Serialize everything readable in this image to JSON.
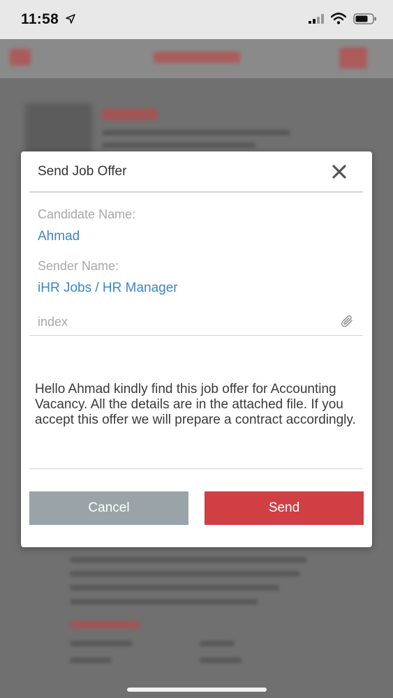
{
  "status_bar": {
    "time": "11:58"
  },
  "modal": {
    "title": "Send Job Offer",
    "candidate_label": "Candidate Name:",
    "candidate_value": "Ahmad",
    "sender_label": "Sender Name:",
    "sender_value": "iHR Jobs / HR Manager",
    "attachment_placeholder": "index",
    "message": "Hello Ahmad kindly find this job offer for Accounting Vacancy. All the details are in the attached file. If you accept this offer we will prepare a contract accordingly.",
    "cancel_label": "Cancel",
    "send_label": "Send"
  },
  "colors": {
    "accent_blue": "#3a86c8",
    "send_red": "#cf3f44",
    "cancel_gray": "#9aa4a8"
  },
  "icons": {
    "close": "close-icon",
    "attach": "paperclip-icon",
    "location": "location-arrow-icon"
  }
}
